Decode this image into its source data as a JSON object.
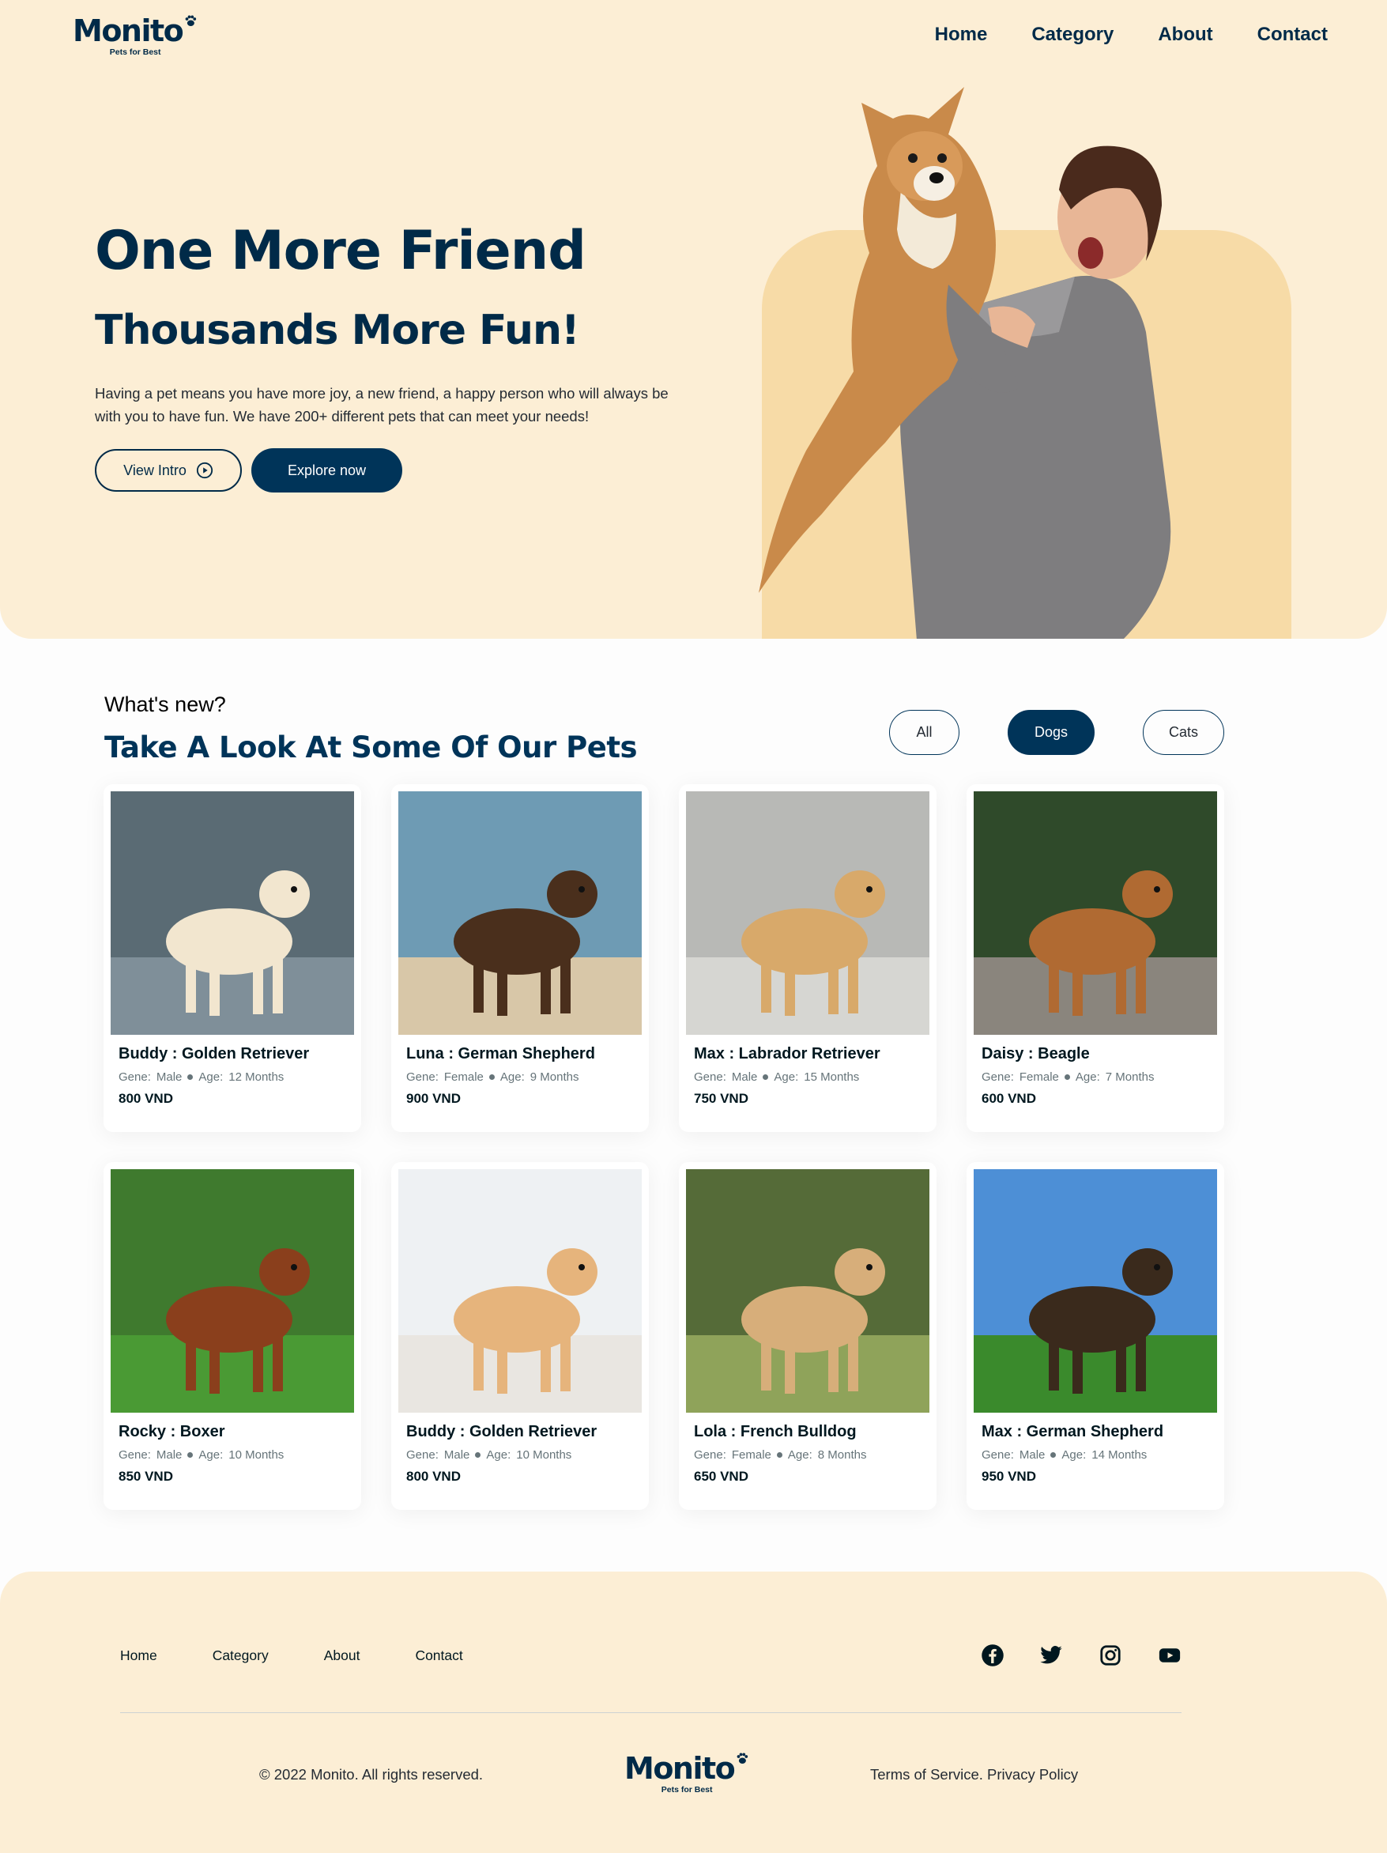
{
  "brand": {
    "name": "Monito",
    "tagline": "Pets for Best"
  },
  "nav": {
    "items": [
      "Home",
      "Category",
      "About",
      "Contact"
    ]
  },
  "hero": {
    "title": "One More Friend",
    "subtitle": "Thousands More Fun!",
    "description": "Having a pet means you have more joy, a new friend, a happy person who will always be with you to have fun. We have 200+ different pets that can meet your needs!",
    "view_intro_label": "View Intro",
    "explore_label": "Explore now"
  },
  "pets_section": {
    "subtitle": "What's new?",
    "title": "Take A Look At Some Of Our Pets",
    "filters": [
      "All",
      "Dogs",
      "Cats"
    ],
    "active_filter": "Dogs",
    "gene_label": "Gene:",
    "age_label": "Age:",
    "pets": [
      {
        "name": "Buddy : Golden Retriever",
        "gene": "Male",
        "age": "12 Months",
        "price": "800 VND"
      },
      {
        "name": "Luna : German Shepherd",
        "gene": "Female",
        "age": "9 Months",
        "price": "900 VND"
      },
      {
        "name": "Max : Labrador Retriever",
        "gene": "Male",
        "age": "15 Months",
        "price": "750 VND"
      },
      {
        "name": "Daisy : Beagle",
        "gene": "Female",
        "age": "7 Months",
        "price": "600 VND"
      },
      {
        "name": "Rocky : Boxer",
        "gene": "Male",
        "age": "10 Months",
        "price": "850 VND"
      },
      {
        "name": "Buddy : Golden Retriever",
        "gene": "Male",
        "age": "10 Months",
        "price": "800 VND"
      },
      {
        "name": "Lola : French Bulldog",
        "gene": "Female",
        "age": "8 Months",
        "price": "650 VND"
      },
      {
        "name": "Max : German Shepherd",
        "gene": "Male",
        "age": "14 Months",
        "price": "950 VND"
      }
    ]
  },
  "footer": {
    "nav": [
      "Home",
      "Category",
      "About",
      "Contact"
    ],
    "social_icons": [
      "facebook-icon",
      "twitter-icon",
      "instagram-icon",
      "youtube-icon"
    ],
    "copyright": "© 2022 Monito. All rights reserved.",
    "terms": "Terms of Service.",
    "privacy": " Privacy Policy"
  },
  "colors": {
    "primary": "#003459",
    "hero_bg": "#fceed5",
    "hero_shape": "#f7dba7",
    "text_dark": "#00171f",
    "muted": "#667479"
  }
}
